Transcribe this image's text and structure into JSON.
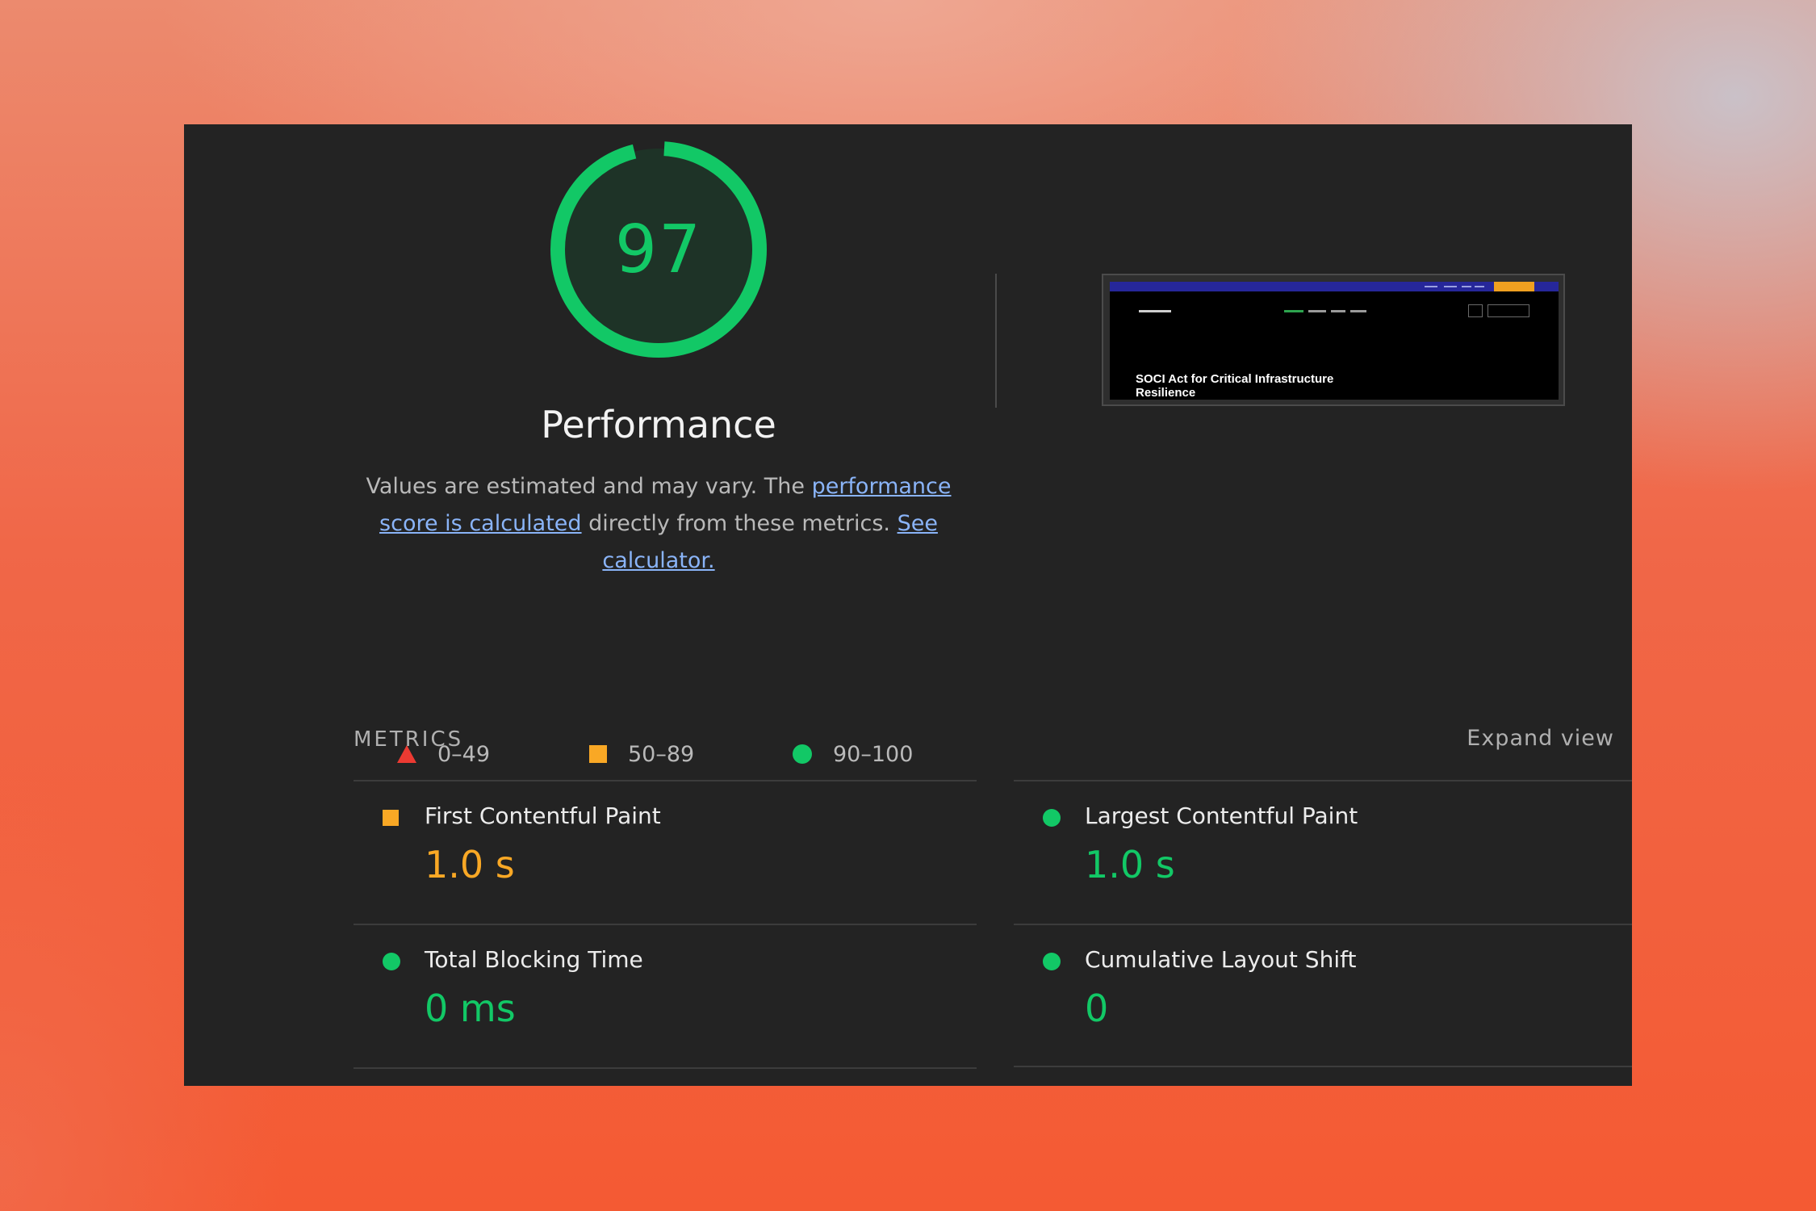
{
  "score": {
    "value": "97",
    "fraction": 0.97,
    "color": "#12c866",
    "title": "Performance"
  },
  "description": {
    "text_1": "Values are estimated and may vary. The ",
    "link_1": "performance score is calculated",
    "text_2": " directly from these metrics. ",
    "link_2": "See calculator."
  },
  "legend": [
    {
      "shape": "triangle",
      "range": "0–49",
      "color": "#ec3a32"
    },
    {
      "shape": "square",
      "range": "50–89",
      "color": "#f9a825"
    },
    {
      "shape": "circle",
      "range": "90–100",
      "color": "#12c866"
    }
  ],
  "screenshot": {
    "heading": "SOCI Act for Critical Infrastructure Resilience"
  },
  "metrics": {
    "label": "METRICS",
    "expand_label": "Expand view",
    "items": [
      {
        "name": "First Contentful Paint",
        "value": "1.0 s",
        "status": "average",
        "color": "#f9a825"
      },
      {
        "name": "Largest Contentful Paint",
        "value": "1.0 s",
        "status": "pass",
        "color": "#12c866"
      },
      {
        "name": "Total Blocking Time",
        "value": "0 ms",
        "status": "pass",
        "color": "#12c866"
      },
      {
        "name": "Cumulative Layout Shift",
        "value": "0",
        "status": "pass",
        "color": "#12c866"
      }
    ]
  }
}
